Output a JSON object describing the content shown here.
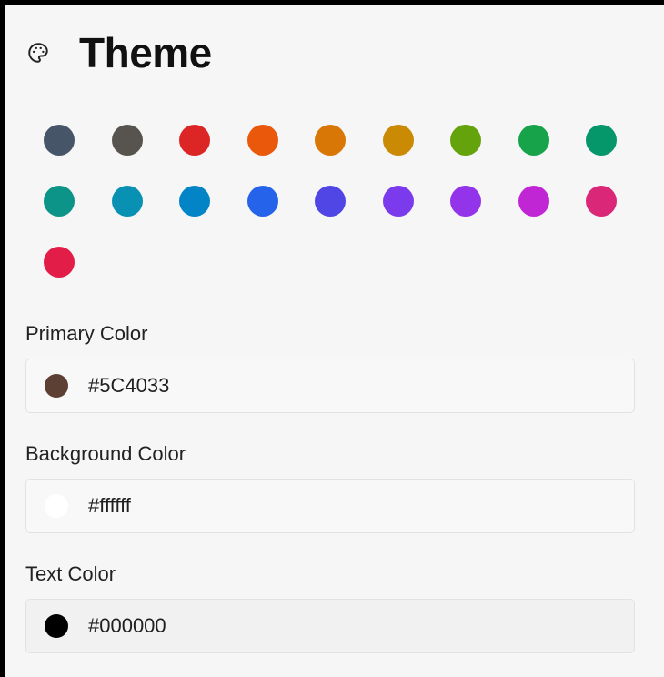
{
  "theme": {
    "title": "Theme",
    "icon": "palette-icon",
    "swatches": [
      "#475569",
      "#57534e",
      "#dc2626",
      "#ea580c",
      "#d97706",
      "#ca8a04",
      "#65a30d",
      "#16a34a",
      "#059669",
      "#0d9488",
      "#0891b2",
      "#0284c7",
      "#2563eb",
      "#4f46e5",
      "#7c3aed",
      "#9333ea",
      "#c026d3",
      "#db2777",
      "#e11d48"
    ]
  },
  "fields": {
    "primary": {
      "label": "Primary Color",
      "value": "#5C4033",
      "swatch": "#5C4033"
    },
    "background": {
      "label": "Background Color",
      "value": "#ffffff",
      "swatch": "#ffffff"
    },
    "text": {
      "label": "Text Color",
      "value": "#000000",
      "swatch": "#000000"
    }
  }
}
